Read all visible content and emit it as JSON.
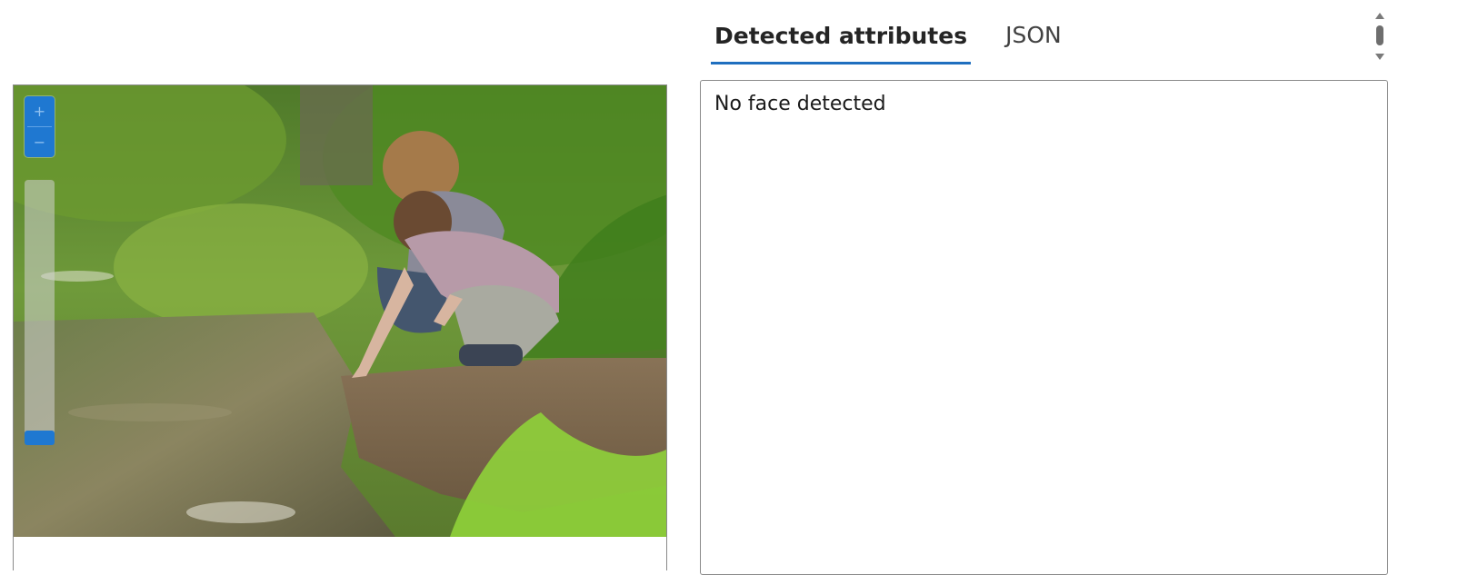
{
  "viewer": {
    "zoom_in_icon": "+",
    "zoom_out_icon": "−",
    "zoom_level": 0.0
  },
  "tabs": [
    {
      "label": "Detected attributes",
      "active": true
    },
    {
      "label": "JSON",
      "active": false
    }
  ],
  "result": {
    "message": "No face detected"
  },
  "colors": {
    "accent": "#1f78d1",
    "tab_underline": "#1f6fbf",
    "border": "#8a8a8a"
  }
}
